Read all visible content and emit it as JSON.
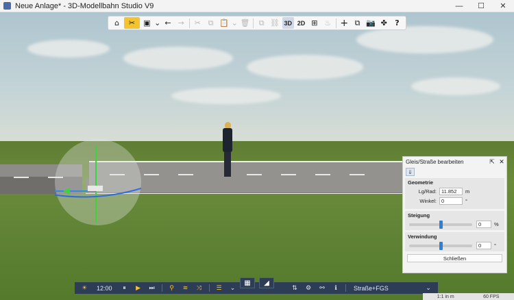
{
  "window": {
    "title": "Neue Anlage* - 3D-Modellbahn Studio V9",
    "minimize": "—",
    "maximize": "☐",
    "close": "✕"
  },
  "toolbar": {
    "home": "⌂",
    "tools": "✂",
    "save": "▣",
    "save_dropdown": "⌄",
    "undo": "←",
    "redo": "→",
    "cut": "✂",
    "copy": "⧉",
    "paste": "📋",
    "paste_dropdown": "⌄",
    "delete": "🗑",
    "duplicate": "⧉",
    "link": "⛓",
    "view_3d": "3D",
    "view_2d": "2D",
    "grid": "⊞",
    "lamp": "♨",
    "add": "+",
    "layers": "⧉",
    "camera": "📷",
    "plugins": "✤",
    "help": "?"
  },
  "panel": {
    "title": "Gleis/Straße bearbeiten",
    "popout": "⇱",
    "close": "✕",
    "pin": "⇓",
    "geometry": {
      "title": "Geometrie",
      "length_label": "Lg/Rad:",
      "length_value": "11.852",
      "length_unit": "m",
      "angle_label": "Winkel:",
      "angle_value": "0",
      "angle_unit": "°"
    },
    "slope": {
      "title": "Steigung",
      "value": "0",
      "unit": "%",
      "level": 0.5
    },
    "twist": {
      "title": "Verwindung",
      "value": "0",
      "unit": "°",
      "level": 0.5
    },
    "close_button": "Schließen"
  },
  "bottombar": {
    "sun": "☀",
    "time": "12:00",
    "pause": "⏸",
    "play": "▶",
    "fast_forward": "⏭",
    "search": "⚲",
    "layers": "≋",
    "shuffle": "⤨",
    "catalog": "☰",
    "catalog_dropdown": "⌄",
    "equalizer": "⇅",
    "settings": "⚙",
    "network": "⚯",
    "info": "ℹ",
    "track_type": "Straße+FGS",
    "track_dropdown": "⌄",
    "view_grid": "▦",
    "view_terrain": "◢"
  },
  "status": {
    "scale": "1:1 in m",
    "fps": "60 FPS"
  }
}
